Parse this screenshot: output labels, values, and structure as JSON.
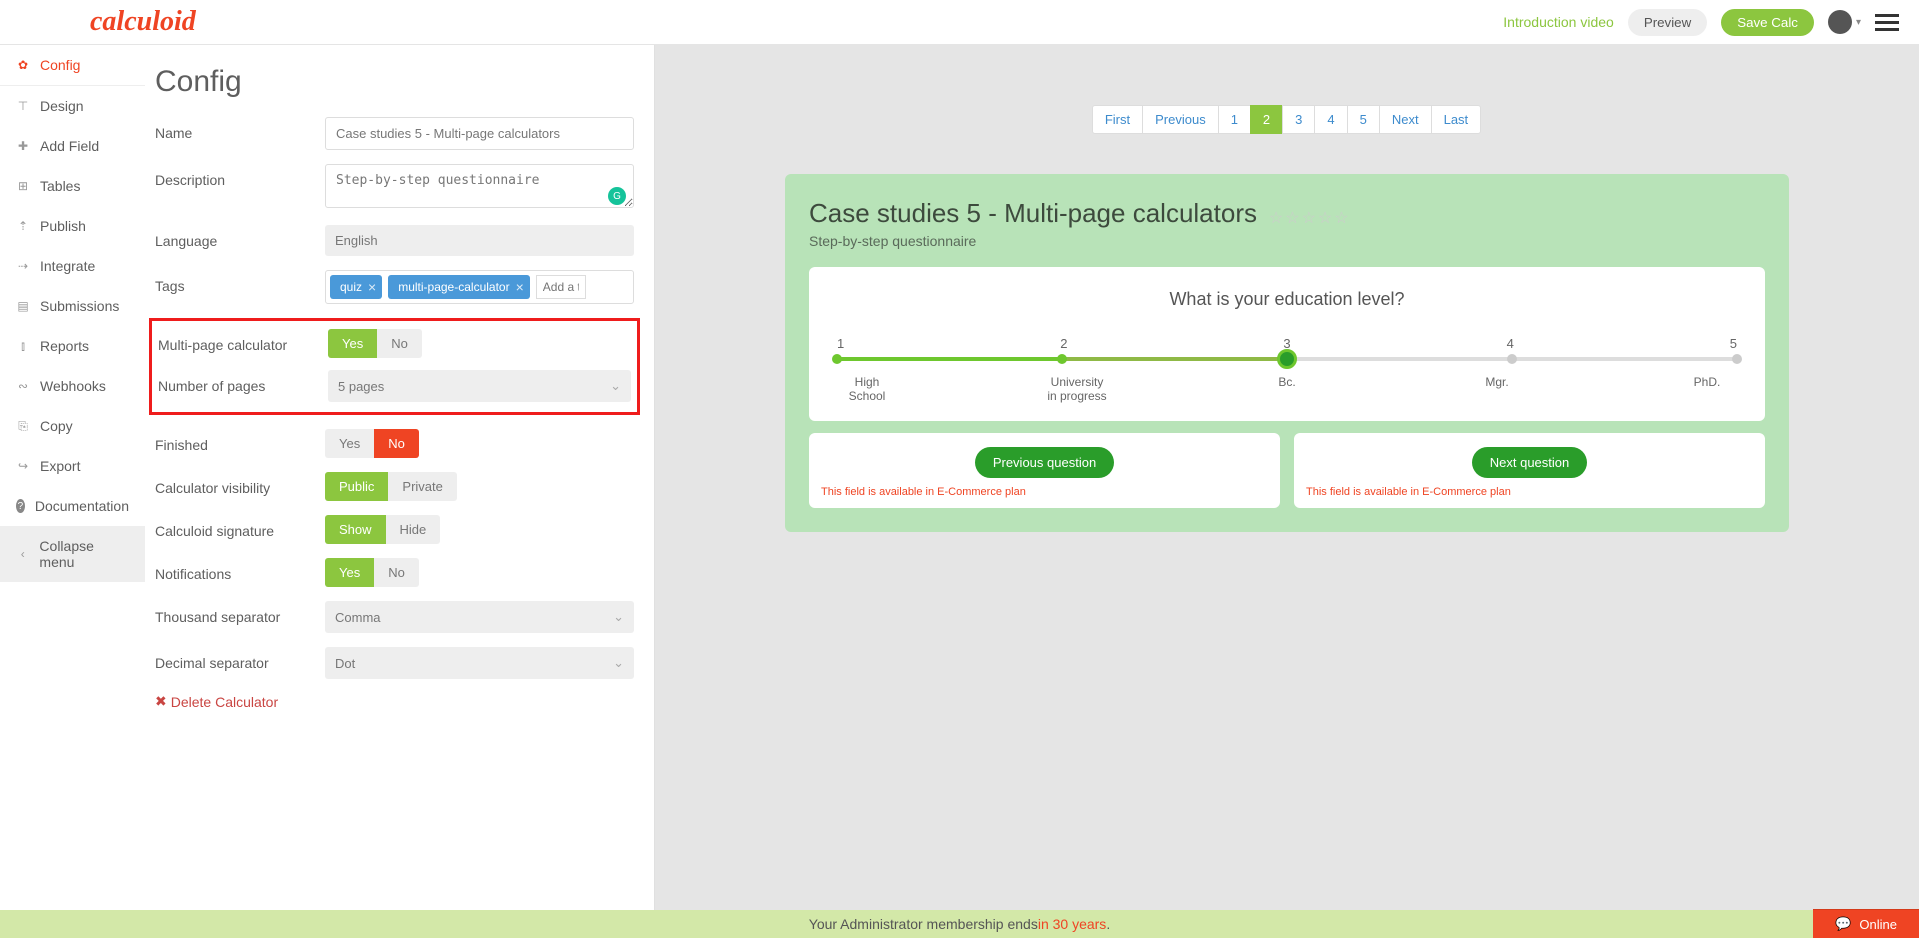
{
  "header": {
    "logo": "calculoid",
    "intro_link": "Introduction video",
    "preview_btn": "Preview",
    "save_btn": "Save Calc"
  },
  "sidebar": {
    "items": [
      {
        "label": "Config",
        "icon": "✿"
      },
      {
        "label": "Design",
        "icon": "⊞"
      },
      {
        "label": "Add Field",
        "icon": "+"
      },
      {
        "label": "Tables",
        "icon": "⊞"
      },
      {
        "label": "Publish",
        "icon": "↑"
      },
      {
        "label": "Integrate",
        "icon": "⇢"
      },
      {
        "label": "Submissions",
        "icon": "▤"
      },
      {
        "label": "Reports",
        "icon": "⫾"
      },
      {
        "label": "Webhooks",
        "icon": "∞"
      },
      {
        "label": "Copy",
        "icon": "⎘"
      },
      {
        "label": "Export",
        "icon": "→"
      },
      {
        "label": "Documentation",
        "icon": "?"
      },
      {
        "label": "Collapse menu",
        "icon": "‹"
      }
    ]
  },
  "config": {
    "title": "Config",
    "name_label": "Name",
    "name_value": "Case studies 5 - Multi-page calculators",
    "desc_label": "Description",
    "desc_value": "Step-by-step questionnaire",
    "lang_label": "Language",
    "lang_value": "English",
    "tags_label": "Tags",
    "tag1": "quiz",
    "tag2": "multi-page-calculator",
    "tag_placeholder": "Add a t",
    "multipage_label": "Multi-page calculator",
    "yes": "Yes",
    "no": "No",
    "pages_label": "Number of pages",
    "pages_value": "5 pages",
    "finished_label": "Finished",
    "visibility_label": "Calculator visibility",
    "public": "Public",
    "private": "Private",
    "signature_label": "Calculoid signature",
    "show": "Show",
    "hide": "Hide",
    "notif_label": "Notifications",
    "thousand_label": "Thousand separator",
    "thousand_value": "Comma",
    "decimal_label": "Decimal separator",
    "decimal_value": "Dot",
    "delete_label": "Delete Calculator"
  },
  "pager": {
    "first": "First",
    "prev": "Previous",
    "p1": "1",
    "p2": "2",
    "p3": "3",
    "p4": "4",
    "p5": "5",
    "next": "Next",
    "last": "Last"
  },
  "preview": {
    "title": "Case studies 5 - Multi-page calculators",
    "subtitle": "Step-by-step questionnaire",
    "question": "What is your education level?",
    "n1": "1",
    "n2": "2",
    "n3": "3",
    "n4": "4",
    "n5": "5",
    "l1": "High School",
    "l2": "University in progress",
    "l3": "Bc.",
    "l4": "Mgr.",
    "l5": "PhD.",
    "prev_q": "Previous question",
    "next_q": "Next question",
    "ecom_note": "This field is available in E-Commerce plan"
  },
  "footer": {
    "text_a": "Your Administrator membership ends ",
    "text_b": "in 30 years",
    "text_c": ".",
    "online": "Online"
  }
}
